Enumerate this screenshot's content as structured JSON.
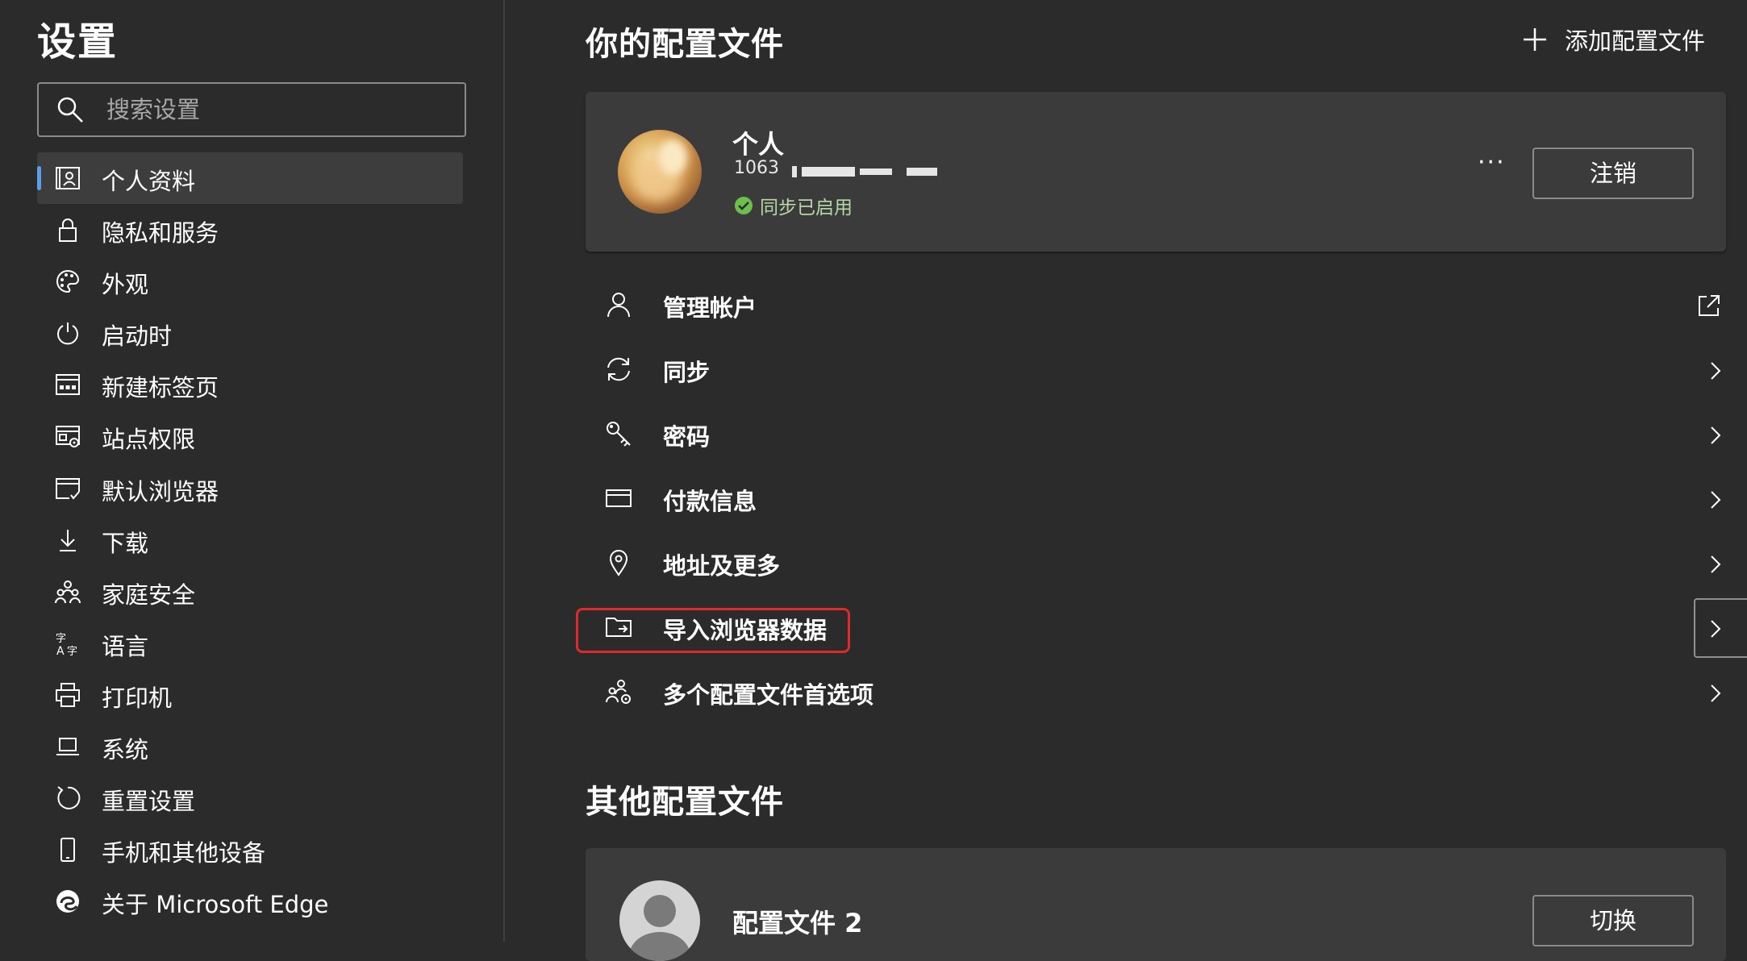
{
  "sidebar": {
    "title": "设置",
    "search_placeholder": "搜索设置",
    "items": [
      {
        "label": "个人资料",
        "icon": "profile-icon",
        "active": true
      },
      {
        "label": "隐私和服务",
        "icon": "lock-icon"
      },
      {
        "label": "外观",
        "icon": "palette-icon"
      },
      {
        "label": "启动时",
        "icon": "power-icon"
      },
      {
        "label": "新建标签页",
        "icon": "new-tab-icon"
      },
      {
        "label": "站点权限",
        "icon": "site-permissions-icon"
      },
      {
        "label": "默认浏览器",
        "icon": "default-browser-icon"
      },
      {
        "label": "下载",
        "icon": "download-icon"
      },
      {
        "label": "家庭安全",
        "icon": "family-icon"
      },
      {
        "label": "语言",
        "icon": "language-icon"
      },
      {
        "label": "打印机",
        "icon": "printer-icon"
      },
      {
        "label": "系统",
        "icon": "system-icon"
      },
      {
        "label": "重置设置",
        "icon": "reset-icon"
      },
      {
        "label": "手机和其他设备",
        "icon": "phone-icon"
      },
      {
        "label": "关于 Microsoft Edge",
        "icon": "edge-logo-icon"
      }
    ]
  },
  "main": {
    "title": "你的配置文件",
    "add_profile_label": "添加配置文件",
    "profile": {
      "name": "个人",
      "email_visible": "1063",
      "sync_status": "同步已启用",
      "more_label": "···",
      "logout_label": "注销"
    },
    "rows": [
      {
        "label": "管理帐户",
        "icon": "person-icon",
        "action": "external-link-icon"
      },
      {
        "label": "同步",
        "icon": "sync-icon",
        "action": "chevron-right-icon"
      },
      {
        "label": "密码",
        "icon": "key-icon",
        "action": "chevron-right-icon"
      },
      {
        "label": "付款信息",
        "icon": "card-icon",
        "action": "chevron-right-icon"
      },
      {
        "label": "地址及更多",
        "icon": "location-icon",
        "action": "chevron-right-icon"
      },
      {
        "label": "导入浏览器数据",
        "icon": "import-folder-icon",
        "action": "chevron-right-icon",
        "highlighted": true
      },
      {
        "label": "多个配置文件首选项",
        "icon": "profiles-settings-icon",
        "action": "chevron-right-icon"
      }
    ],
    "other_title": "其他配置文件",
    "other_profile": {
      "name": "配置文件 2",
      "switch_label": "切换"
    }
  },
  "colors": {
    "background": "#2b2b2b",
    "card": "#3b3b3b",
    "accent": "#5aa0e6",
    "sync_green": "#6cc04a",
    "highlight_red": "#e02a2a"
  }
}
